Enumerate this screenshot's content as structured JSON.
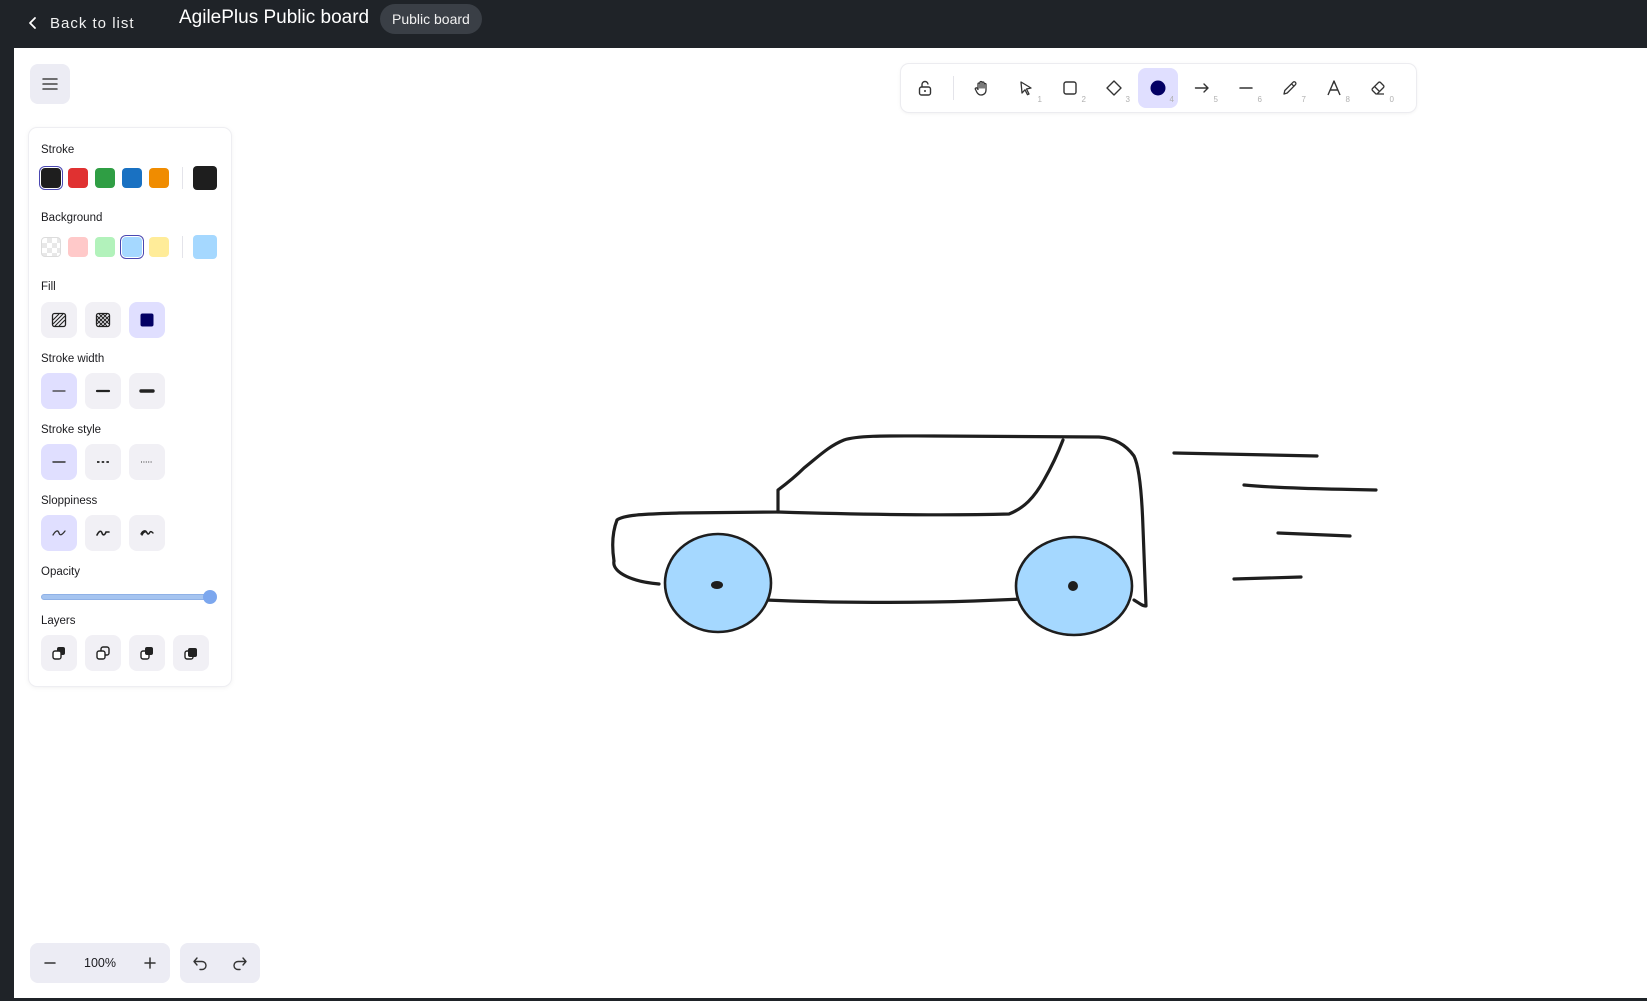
{
  "header": {
    "back_label": "Back to list",
    "title": "AgilePlus Public board",
    "badge": "Public board"
  },
  "toolbar": {
    "tools": [
      {
        "name": "lock-icon",
        "key": ""
      },
      {
        "name": "hand-icon",
        "key": ""
      },
      {
        "name": "selection-icon",
        "key": "1"
      },
      {
        "name": "rectangle-icon",
        "key": "2"
      },
      {
        "name": "diamond-icon",
        "key": "3"
      },
      {
        "name": "ellipse-icon",
        "key": "4",
        "active": true
      },
      {
        "name": "arrow-icon",
        "key": "5"
      },
      {
        "name": "line-icon",
        "key": "6"
      },
      {
        "name": "pencil-icon",
        "key": "7"
      },
      {
        "name": "text-icon",
        "key": "8"
      },
      {
        "name": "eraser-icon",
        "key": "0"
      }
    ]
  },
  "panel": {
    "stroke_label": "Stroke",
    "stroke_colors": [
      "#1e1e1e",
      "#e03131",
      "#2f9e44",
      "#1971c2",
      "#f08c00"
    ],
    "stroke_selected": "#1e1e1e",
    "background_label": "Background",
    "background_colors": [
      "transparent",
      "#ffc9c9",
      "#b2f2bb",
      "#a5d8ff",
      "#ffec99"
    ],
    "background_selected": "#a5d8ff",
    "fill_label": "Fill",
    "stroke_width_label": "Stroke width",
    "stroke_style_label": "Stroke style",
    "sloppiness_label": "Sloppiness",
    "opacity_label": "Opacity",
    "opacity_value": 100,
    "layers_label": "Layers"
  },
  "footer": {
    "zoom_level": "100%"
  },
  "colors": {
    "accent": "#e0dfff",
    "wheel_fill": "#a5d8ff",
    "ink": "#1e1e1e"
  }
}
